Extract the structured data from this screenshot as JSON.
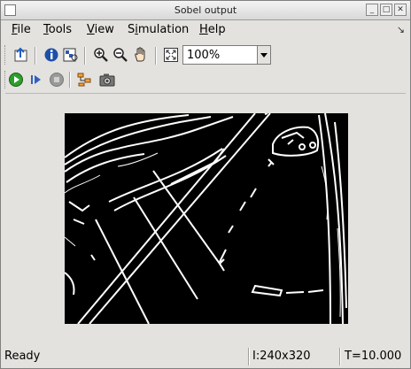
{
  "window": {
    "title": "Sobel output"
  },
  "menu": {
    "items": [
      {
        "label": "File",
        "underline": "F",
        "rest": "ile"
      },
      {
        "label": "Tools",
        "underline": "T",
        "rest": "ools"
      },
      {
        "label": "View",
        "underline": "V",
        "rest": "iew"
      },
      {
        "label": "Simulation",
        "pre": "S",
        "underline": "i",
        "rest": "mulation"
      },
      {
        "label": "Help",
        "underline": "H",
        "rest": "elp"
      }
    ]
  },
  "toolbar": {
    "zoom_value": "100%",
    "icons": [
      "print-to-figure-icon",
      "info-icon",
      "pixel-region-icon",
      "zoom-in-icon",
      "zoom-out-icon",
      "pan-hand-icon",
      "fit-to-window-icon"
    ],
    "sim_icons": [
      "play-icon",
      "step-forward-icon",
      "stop-icon",
      "highlight-model-icon",
      "snapshot-icon"
    ]
  },
  "status": {
    "text": "Ready",
    "dimensions": "I:240x320",
    "time": "T=10.000"
  },
  "colors": {
    "play": "#2e9e2e",
    "step": "#3060c0",
    "stop": "#8c8c8c"
  }
}
